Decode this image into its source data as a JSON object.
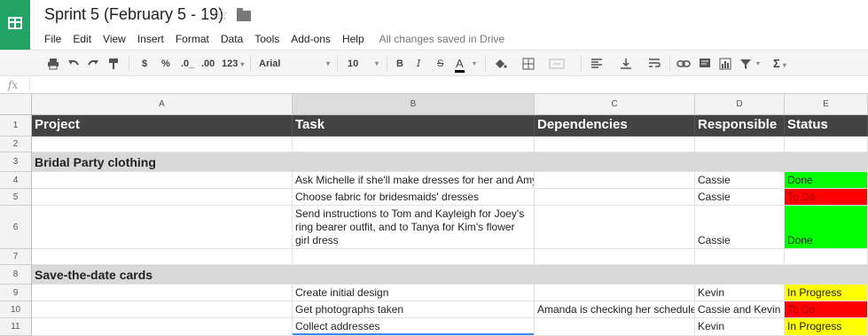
{
  "app": {
    "doc_title": "Sprint 5 (February 5 - 19)",
    "star_icon": "star-outline-icon",
    "folder_icon": "folder-icon",
    "save_status": "All changes saved in Drive",
    "brand_color": "#21a464"
  },
  "menu": [
    "File",
    "Edit",
    "View",
    "Insert",
    "Format",
    "Data",
    "Tools",
    "Add-ons",
    "Help"
  ],
  "toolbar": {
    "currency": "$",
    "percent": "%",
    "dec_decrease": ".0_",
    "dec_increase": ".00",
    "more_formats": "123",
    "font": "Arial",
    "font_size": "10",
    "bold": "B",
    "italic": "I",
    "strike": "S",
    "text_color": "A",
    "functions": "Σ",
    "icons": [
      "print-icon",
      "undo-icon",
      "redo-icon",
      "paint-format-icon",
      "fill-color-icon",
      "borders-icon",
      "merge-icon",
      "align-icon",
      "valign-icon",
      "wrap-icon",
      "link-icon",
      "comment-icon",
      "chart-icon",
      "filter-icon",
      "functions-icon"
    ]
  },
  "formula_bar": {
    "label": "fx",
    "value": ""
  },
  "columns": [
    "A",
    "B",
    "C",
    "D",
    "E"
  ],
  "header_row": {
    "project": "Project",
    "task": "Task",
    "dependencies": "Dependencies",
    "responsible": "Responsible",
    "status": "Status"
  },
  "rows": [
    {
      "num": "1"
    },
    {
      "num": "2"
    },
    {
      "num": "3",
      "section": "Bridal Party clothing"
    },
    {
      "num": "4",
      "task": "Ask Michelle if she'll make dresses for her and Amy",
      "dependencies": "",
      "responsible": "Cassie",
      "status": "Done"
    },
    {
      "num": "5",
      "task": "Choose fabric for bridesmaids' dresses",
      "dependencies": "",
      "responsible": "Cassie",
      "status": "To Do"
    },
    {
      "num": "6",
      "task": "Send instructions to Tom and Kayleigh for Joey's ring bearer outfit, and to Tanya for Kim's flower girl dress",
      "dependencies": "",
      "responsible": "Cassie",
      "status": "Done"
    },
    {
      "num": "7"
    },
    {
      "num": "8",
      "section": "Save-the-date cards"
    },
    {
      "num": "9",
      "task": "Create initial design",
      "dependencies": "",
      "responsible": "Kevin",
      "status": "In Progress"
    },
    {
      "num": "10",
      "task": "Get photographs taken",
      "dependencies": "Amanda is checking her schedule",
      "responsible": "Cassie and Kevin",
      "status": "To Do"
    },
    {
      "num": "11",
      "task": "Collect addresses",
      "dependencies": "",
      "responsible": "Kevin",
      "status": "In Progress"
    }
  ],
  "status_colors": {
    "Done": "#00ff00",
    "To Do": "#ff0000",
    "In Progress": "#ffff00"
  }
}
